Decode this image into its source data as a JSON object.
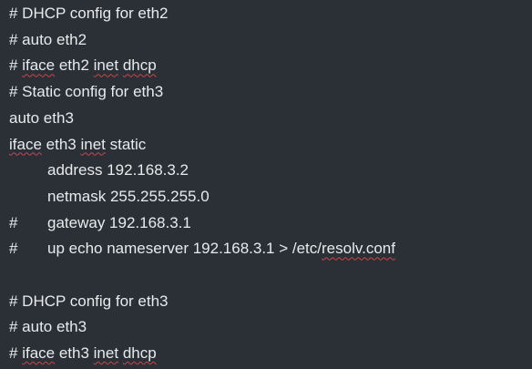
{
  "editor": {
    "background": "#2b3036",
    "text_color": "#e8eaec",
    "spellcheck_color": "#d0424a",
    "lines": [
      {
        "prefix": "",
        "parts": [
          {
            "t": "# DHCP config for eth2",
            "sq": false
          }
        ]
      },
      {
        "prefix": "",
        "parts": [
          {
            "t": "# auto eth2",
            "sq": false
          }
        ]
      },
      {
        "prefix": "",
        "parts": [
          {
            "t": "# ",
            "sq": false
          },
          {
            "t": "iface",
            "sq": true
          },
          {
            "t": " eth2 ",
            "sq": false
          },
          {
            "t": "inet",
            "sq": true
          },
          {
            "t": " ",
            "sq": false
          },
          {
            "t": "dhcp",
            "sq": true
          }
        ]
      },
      {
        "prefix": "",
        "parts": [
          {
            "t": "# Static config for eth3",
            "sq": false
          }
        ]
      },
      {
        "prefix": "",
        "parts": [
          {
            "t": "auto eth3",
            "sq": false
          }
        ]
      },
      {
        "prefix": "",
        "parts": [
          {
            "t": "iface",
            "sq": true
          },
          {
            "t": " eth3 ",
            "sq": false
          },
          {
            "t": "inet",
            "sq": true
          },
          {
            "t": " static",
            "sq": false
          }
        ]
      },
      {
        "prefix": "",
        "indent": true,
        "parts": [
          {
            "t": "address 192.168.3.2",
            "sq": false
          }
        ]
      },
      {
        "prefix": "",
        "indent": true,
        "parts": [
          {
            "t": "netmask 255.255.255.0",
            "sq": false
          }
        ]
      },
      {
        "prefix": "#",
        "indent": true,
        "parts": [
          {
            "t": "gateway 192.168.3.1",
            "sq": false
          }
        ]
      },
      {
        "prefix": "#",
        "indent": true,
        "parts": [
          {
            "t": "up echo nameserver 192.168.3.1 > /etc/",
            "sq": false
          },
          {
            "t": "resolv.conf",
            "sq": true
          }
        ]
      },
      {
        "prefix": "",
        "parts": [
          {
            "t": "",
            "sq": false
          }
        ]
      },
      {
        "prefix": "",
        "parts": [
          {
            "t": "# DHCP config for eth3",
            "sq": false
          }
        ]
      },
      {
        "prefix": "",
        "parts": [
          {
            "t": "# auto eth3",
            "sq": false
          }
        ]
      },
      {
        "prefix": "",
        "parts": [
          {
            "t": "# ",
            "sq": false
          },
          {
            "t": "iface",
            "sq": true
          },
          {
            "t": " eth3 ",
            "sq": false
          },
          {
            "t": "inet",
            "sq": true
          },
          {
            "t": " ",
            "sq": false
          },
          {
            "t": "dhcp",
            "sq": true
          }
        ]
      }
    ]
  }
}
